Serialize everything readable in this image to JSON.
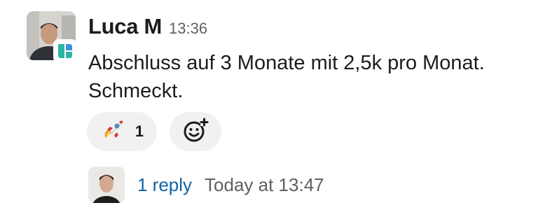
{
  "message": {
    "author": "Luca M",
    "timestamp": "13:36",
    "text": "Abschluss auf 3 Monate mit 2,5k pro Monat. Schmeckt.",
    "avatar_icon": "user-photo",
    "badge_icon": "app-badge-icon"
  },
  "reactions": [
    {
      "emoji": "🚀",
      "icon": "rocket-icon",
      "count": "1"
    }
  ],
  "add_reaction": {
    "icon": "add-reaction-icon"
  },
  "thread": {
    "reply_count": "1 reply",
    "last_reply": "Today at 13:47",
    "avatar_icon": "replier-photo"
  },
  "colors": {
    "link": "#1264a3",
    "muted": "#616061",
    "pill_bg": "#f2f1f1",
    "text": "#1d1c1d",
    "badge_teal": "#2bb5a3",
    "badge_blue": "#3f8de0"
  }
}
